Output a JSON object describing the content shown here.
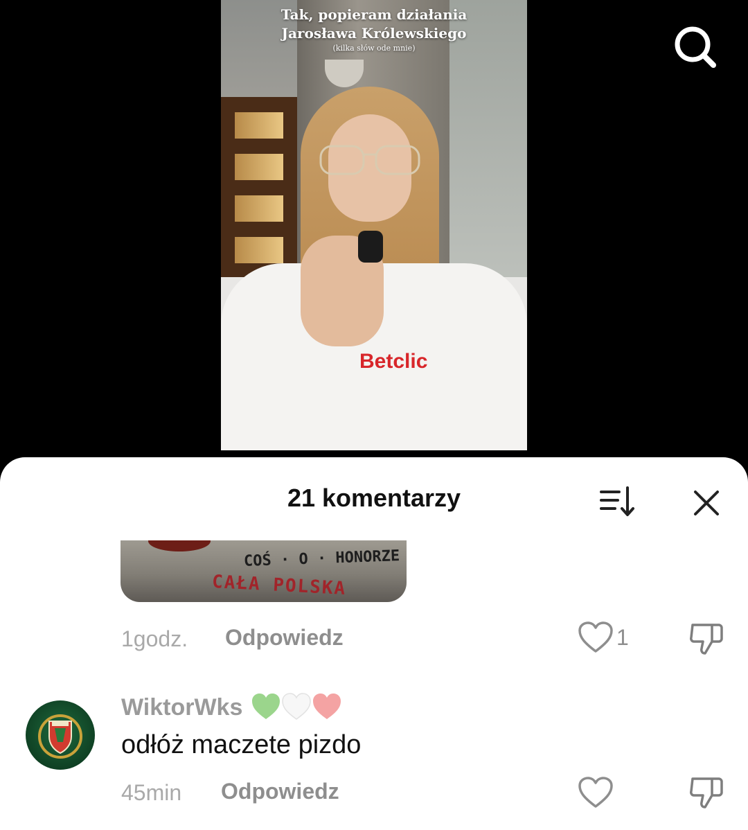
{
  "video": {
    "caption_line1": "Tak, popieram działania",
    "caption_line2": "Jarosława Królewskiego",
    "caption_sub": "(kilka słów ode mnie)",
    "shirt_logo": "Betclic"
  },
  "search": {
    "icon": "search-icon"
  },
  "comments_panel": {
    "title": "21 komentarzy",
    "sort_icon": "sort-icon",
    "close_icon": "close-icon",
    "comments": [
      {
        "image_text_1": "COŚ · O · HONORZE",
        "image_text_2": "CAŁA POLSKA",
        "time": "1godz.",
        "reply_label": "Odpowiedz",
        "likes": "1"
      },
      {
        "username": "WiktorWks",
        "user_emoji": [
          "green-heart",
          "white-heart",
          "pink-heart"
        ],
        "text": "odłóż maczete pizdo",
        "time": "45min",
        "reply_label": "Odpowiedz",
        "likes": ""
      }
    ]
  },
  "colors": {
    "sheet_bg": "#ffffff",
    "muted_text": "#8e8e8e",
    "primary_text": "#111111",
    "green_heart": "#9bd58c",
    "pink_heart": "#f4a3a3"
  }
}
